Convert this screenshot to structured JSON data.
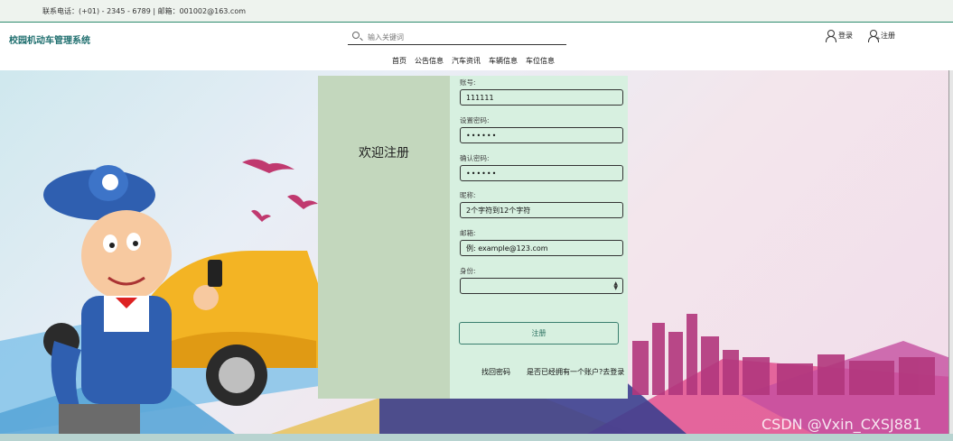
{
  "topbar": {
    "contact": "联系电话：(+01) - 2345 - 6789 | 邮箱：001002@163.com"
  },
  "header": {
    "site_title": "校园机动车管理系统",
    "search_placeholder": "输入关键词",
    "login_label": "登录",
    "register_label": "注册"
  },
  "nav": {
    "items": [
      "首页",
      "公告信息",
      "汽车资讯",
      "车辆信息",
      "车位信息"
    ]
  },
  "register": {
    "welcome": "欢迎注册",
    "fields": {
      "account_label": "账号:",
      "account_value": "111111",
      "password_label": "设置密码:",
      "password_value": "111111",
      "confirm_label": "确认密码:",
      "confirm_value": "111111",
      "nickname_label": "昵称:",
      "nickname_placeholder": "2个字符到12个字符",
      "email_label": "邮箱:",
      "email_placeholder": "例: example@123.com",
      "identity_label": "身份:",
      "identity_value": ""
    },
    "submit_label": "注册",
    "forgot_label": "找回密码",
    "to_login_label": "是否已经拥有一个账户?去登录"
  },
  "watermark": "CSDN @Vxin_CXSJ881",
  "colors": {
    "accent": "#2e8b6e",
    "panel_left": "#c3d7bd",
    "panel_right": "#d7f0e0",
    "title": "#1e6e6e"
  }
}
